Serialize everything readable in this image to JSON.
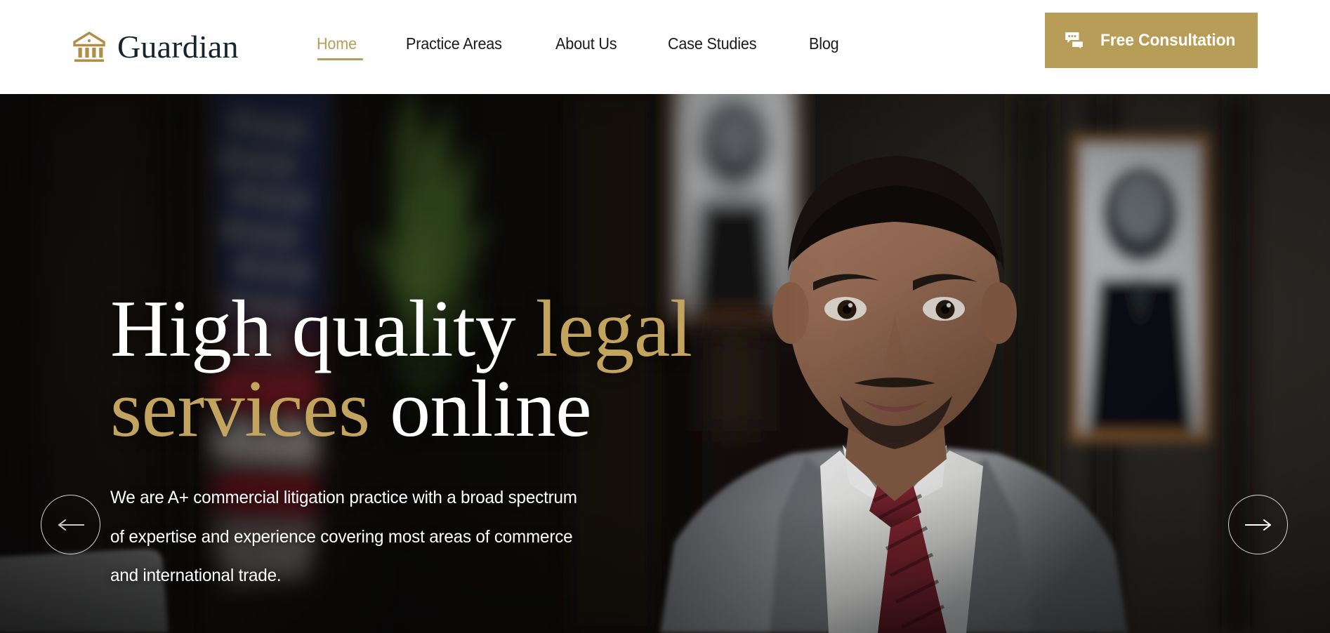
{
  "header": {
    "brand": {
      "icon": "classical-building-icon",
      "name": "Guardian"
    },
    "nav": [
      {
        "label": "Home",
        "active": true
      },
      {
        "label": "Practice Areas",
        "active": false
      },
      {
        "label": "About Us",
        "active": false
      },
      {
        "label": "Case Studies",
        "active": false
      },
      {
        "label": "Blog",
        "active": false
      }
    ],
    "cta": {
      "label": "Free Consultation",
      "icon": "chat-bubbles-icon"
    }
  },
  "hero": {
    "title_line1_white": "High quality ",
    "title_line1_gold": "legal",
    "title_line2_gold": "services",
    "title_line2_white": " online",
    "subtitle": "We are A+ commercial litigation practice with a broad spectrum of expertise and experience covering most areas of commerce and international trade.",
    "prev_label": "Previous slide",
    "next_label": "Next slide",
    "image_description": "Lawyer in a grey suit with a dark red striped tie seated in a dark wood office, American flag and framed portraits behind him"
  },
  "colors": {
    "gold": "#b89d58",
    "gold_text": "#c2a45e",
    "brand_dark": "#16242c",
    "nav_text": "#1a1a1a",
    "header_bg": "#ffffff",
    "hero_bg": "#0a0908",
    "white": "#ffffff"
  }
}
